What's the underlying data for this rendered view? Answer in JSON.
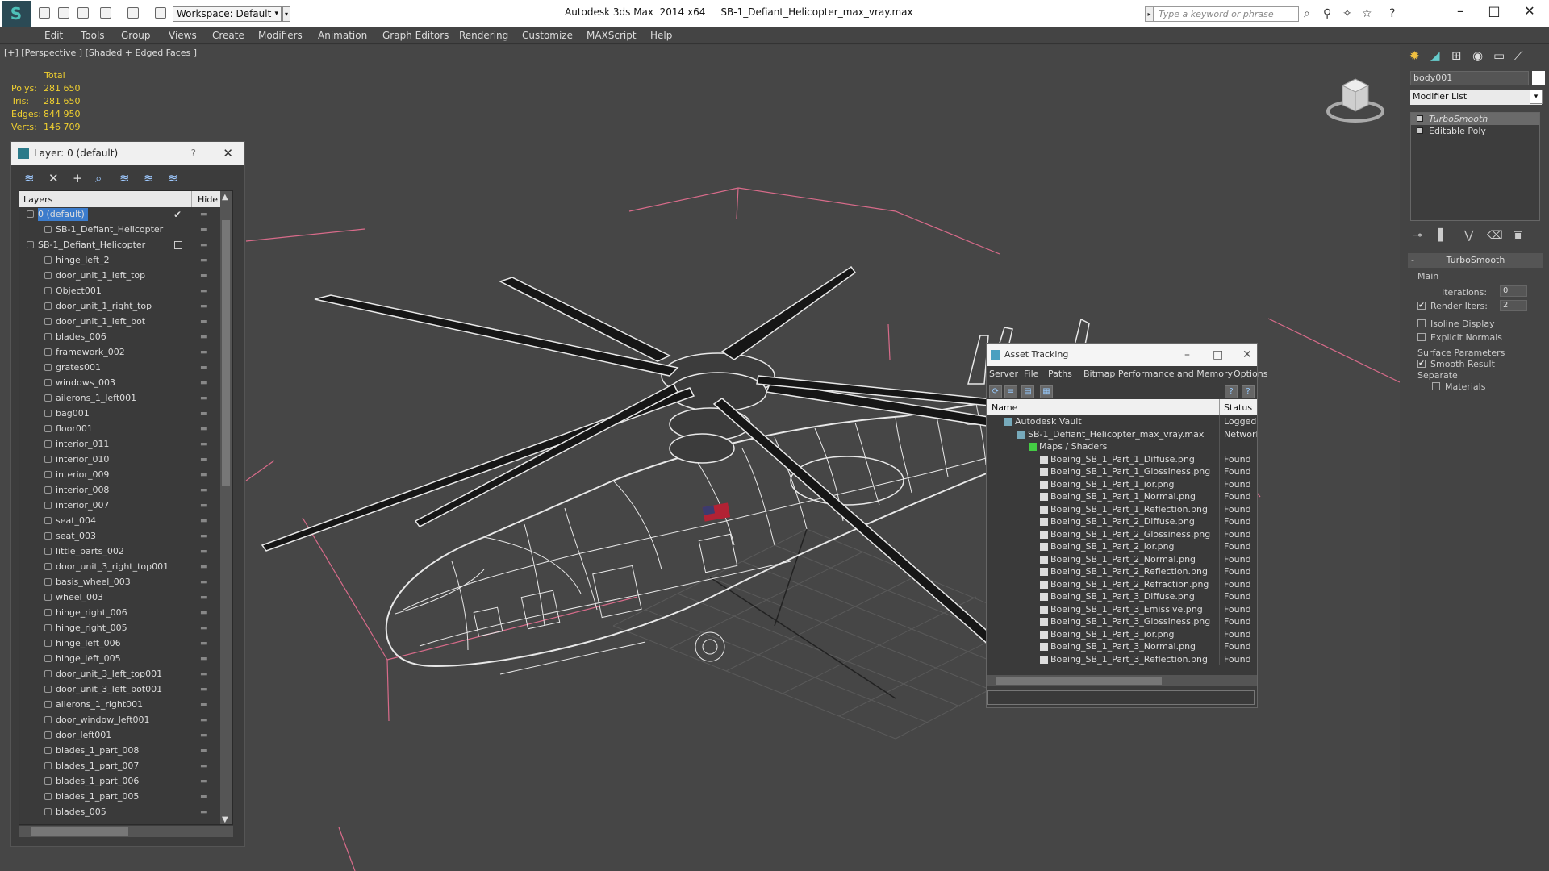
{
  "titlebar": {
    "workspace": "Workspace: Default",
    "title": "Autodesk 3ds Max  2014 x64     SB-1_Defiant_Helicopter_max_vray.max",
    "search_placeholder": "Type a keyword or phrase"
  },
  "menu": [
    "Edit",
    "Tools",
    "Group",
    "Views",
    "Create",
    "Modifiers",
    "Animation",
    "Graph Editors",
    "Rendering",
    "Customize",
    "MAXScript",
    "Help"
  ],
  "viewport": {
    "label": "[+] [Perspective ] [Shaded + Edged Faces ]",
    "stats": {
      "header": "Total",
      "rows": [
        {
          "k": "Polys:",
          "v": "281 650"
        },
        {
          "k": "Tris:",
          "v": "281 650"
        },
        {
          "k": "Edges:",
          "v": "844 950"
        },
        {
          "k": "Verts:",
          "v": "146 709"
        }
      ]
    }
  },
  "layer_panel": {
    "title": "Layer: 0 (default)",
    "help": "?",
    "col_layers": "Layers",
    "col_hide": "Hide",
    "rows": [
      {
        "name": "0 (default)",
        "level": 0,
        "selected": true,
        "check": "✔"
      },
      {
        "name": "SB-1_Defiant_Helicopter",
        "level": 1
      },
      {
        "name": "SB-1_Defiant_Helicopter",
        "level": 0,
        "box": true
      },
      {
        "name": "hinge_left_2",
        "level": 1
      },
      {
        "name": "door_unit_1_left_top",
        "level": 1
      },
      {
        "name": "Object001",
        "level": 1
      },
      {
        "name": "door_unit_1_right_top",
        "level": 1
      },
      {
        "name": "door_unit_1_left_bot",
        "level": 1
      },
      {
        "name": "blades_006",
        "level": 1
      },
      {
        "name": "framework_002",
        "level": 1
      },
      {
        "name": "grates001",
        "level": 1
      },
      {
        "name": "windows_003",
        "level": 1
      },
      {
        "name": "ailerons_1_left001",
        "level": 1
      },
      {
        "name": "bag001",
        "level": 1
      },
      {
        "name": "floor001",
        "level": 1
      },
      {
        "name": "interior_011",
        "level": 1
      },
      {
        "name": "interior_010",
        "level": 1
      },
      {
        "name": "interior_009",
        "level": 1
      },
      {
        "name": "interior_008",
        "level": 1
      },
      {
        "name": "interior_007",
        "level": 1
      },
      {
        "name": "seat_004",
        "level": 1
      },
      {
        "name": "seat_003",
        "level": 1
      },
      {
        "name": "little_parts_002",
        "level": 1
      },
      {
        "name": "door_unit_3_right_top001",
        "level": 1
      },
      {
        "name": "basis_wheel_003",
        "level": 1
      },
      {
        "name": "wheel_003",
        "level": 1
      },
      {
        "name": "hinge_right_006",
        "level": 1
      },
      {
        "name": "hinge_right_005",
        "level": 1
      },
      {
        "name": "hinge_left_006",
        "level": 1
      },
      {
        "name": "hinge_left_005",
        "level": 1
      },
      {
        "name": "door_unit_3_left_top001",
        "level": 1
      },
      {
        "name": "door_unit_3_left_bot001",
        "level": 1
      },
      {
        "name": "ailerons_1_right001",
        "level": 1
      },
      {
        "name": "door_window_left001",
        "level": 1
      },
      {
        "name": "door_left001",
        "level": 1
      },
      {
        "name": "blades_1_part_008",
        "level": 1
      },
      {
        "name": "blades_1_part_007",
        "level": 1
      },
      {
        "name": "blades_1_part_006",
        "level": 1
      },
      {
        "name": "blades_1_part_005",
        "level": 1
      },
      {
        "name": "blades_005",
        "level": 1
      }
    ]
  },
  "command_panel": {
    "object_name": "body001",
    "modifier_list": "Modifier List",
    "stack": [
      {
        "name": "TurboSmooth",
        "selected": true
      },
      {
        "name": "Editable Poly",
        "selected": false
      }
    ],
    "rollout_title": "TurboSmooth",
    "main_group": "Main",
    "iterations_label": "Iterations:",
    "iterations_value": "0",
    "render_iters_label": "Render Iters:",
    "render_iters_value": "2",
    "isoline_label": "Isoline Display",
    "explicit_normals_label": "Explicit Normals",
    "surface_group": "Surface Parameters",
    "smooth_result_label": "Smooth Result",
    "separate_label": "Separate",
    "materials_label": "Materials"
  },
  "asset_tracking": {
    "title": "Asset Tracking",
    "menu": [
      "Server",
      "File",
      "Paths",
      "Bitmap Performance and Memory",
      "Options"
    ],
    "col_name": "Name",
    "col_status": "Status",
    "rows": [
      {
        "name": "Autodesk Vault",
        "level": 0,
        "status": "Logged C"
      },
      {
        "name": "SB-1_Defiant_Helicopter_max_vray.max",
        "level": 1,
        "status": "Network"
      },
      {
        "name": "Maps / Shaders",
        "level": 2,
        "status": ""
      },
      {
        "name": "Boeing_SB_1_Part_1_Diffuse.png",
        "level": 3,
        "status": "Found"
      },
      {
        "name": "Boeing_SB_1_Part_1_Glossiness.png",
        "level": 3,
        "status": "Found"
      },
      {
        "name": "Boeing_SB_1_Part_1_ior.png",
        "level": 3,
        "status": "Found"
      },
      {
        "name": "Boeing_SB_1_Part_1_Normal.png",
        "level": 3,
        "status": "Found"
      },
      {
        "name": "Boeing_SB_1_Part_1_Reflection.png",
        "level": 3,
        "status": "Found"
      },
      {
        "name": "Boeing_SB_1_Part_2_Diffuse.png",
        "level": 3,
        "status": "Found"
      },
      {
        "name": "Boeing_SB_1_Part_2_Glossiness.png",
        "level": 3,
        "status": "Found"
      },
      {
        "name": "Boeing_SB_1_Part_2_ior.png",
        "level": 3,
        "status": "Found"
      },
      {
        "name": "Boeing_SB_1_Part_2_Normal.png",
        "level": 3,
        "status": "Found"
      },
      {
        "name": "Boeing_SB_1_Part_2_Reflection.png",
        "level": 3,
        "status": "Found"
      },
      {
        "name": "Boeing_SB_1_Part_2_Refraction.png",
        "level": 3,
        "status": "Found"
      },
      {
        "name": "Boeing_SB_1_Part_3_Diffuse.png",
        "level": 3,
        "status": "Found"
      },
      {
        "name": "Boeing_SB_1_Part_3_Emissive.png",
        "level": 3,
        "status": "Found"
      },
      {
        "name": "Boeing_SB_1_Part_3_Glossiness.png",
        "level": 3,
        "status": "Found"
      },
      {
        "name": "Boeing_SB_1_Part_3_ior.png",
        "level": 3,
        "status": "Found"
      },
      {
        "name": "Boeing_SB_1_Part_3_Normal.png",
        "level": 3,
        "status": "Found"
      },
      {
        "name": "Boeing_SB_1_Part_3_Reflection.png",
        "level": 3,
        "status": "Found"
      }
    ]
  }
}
